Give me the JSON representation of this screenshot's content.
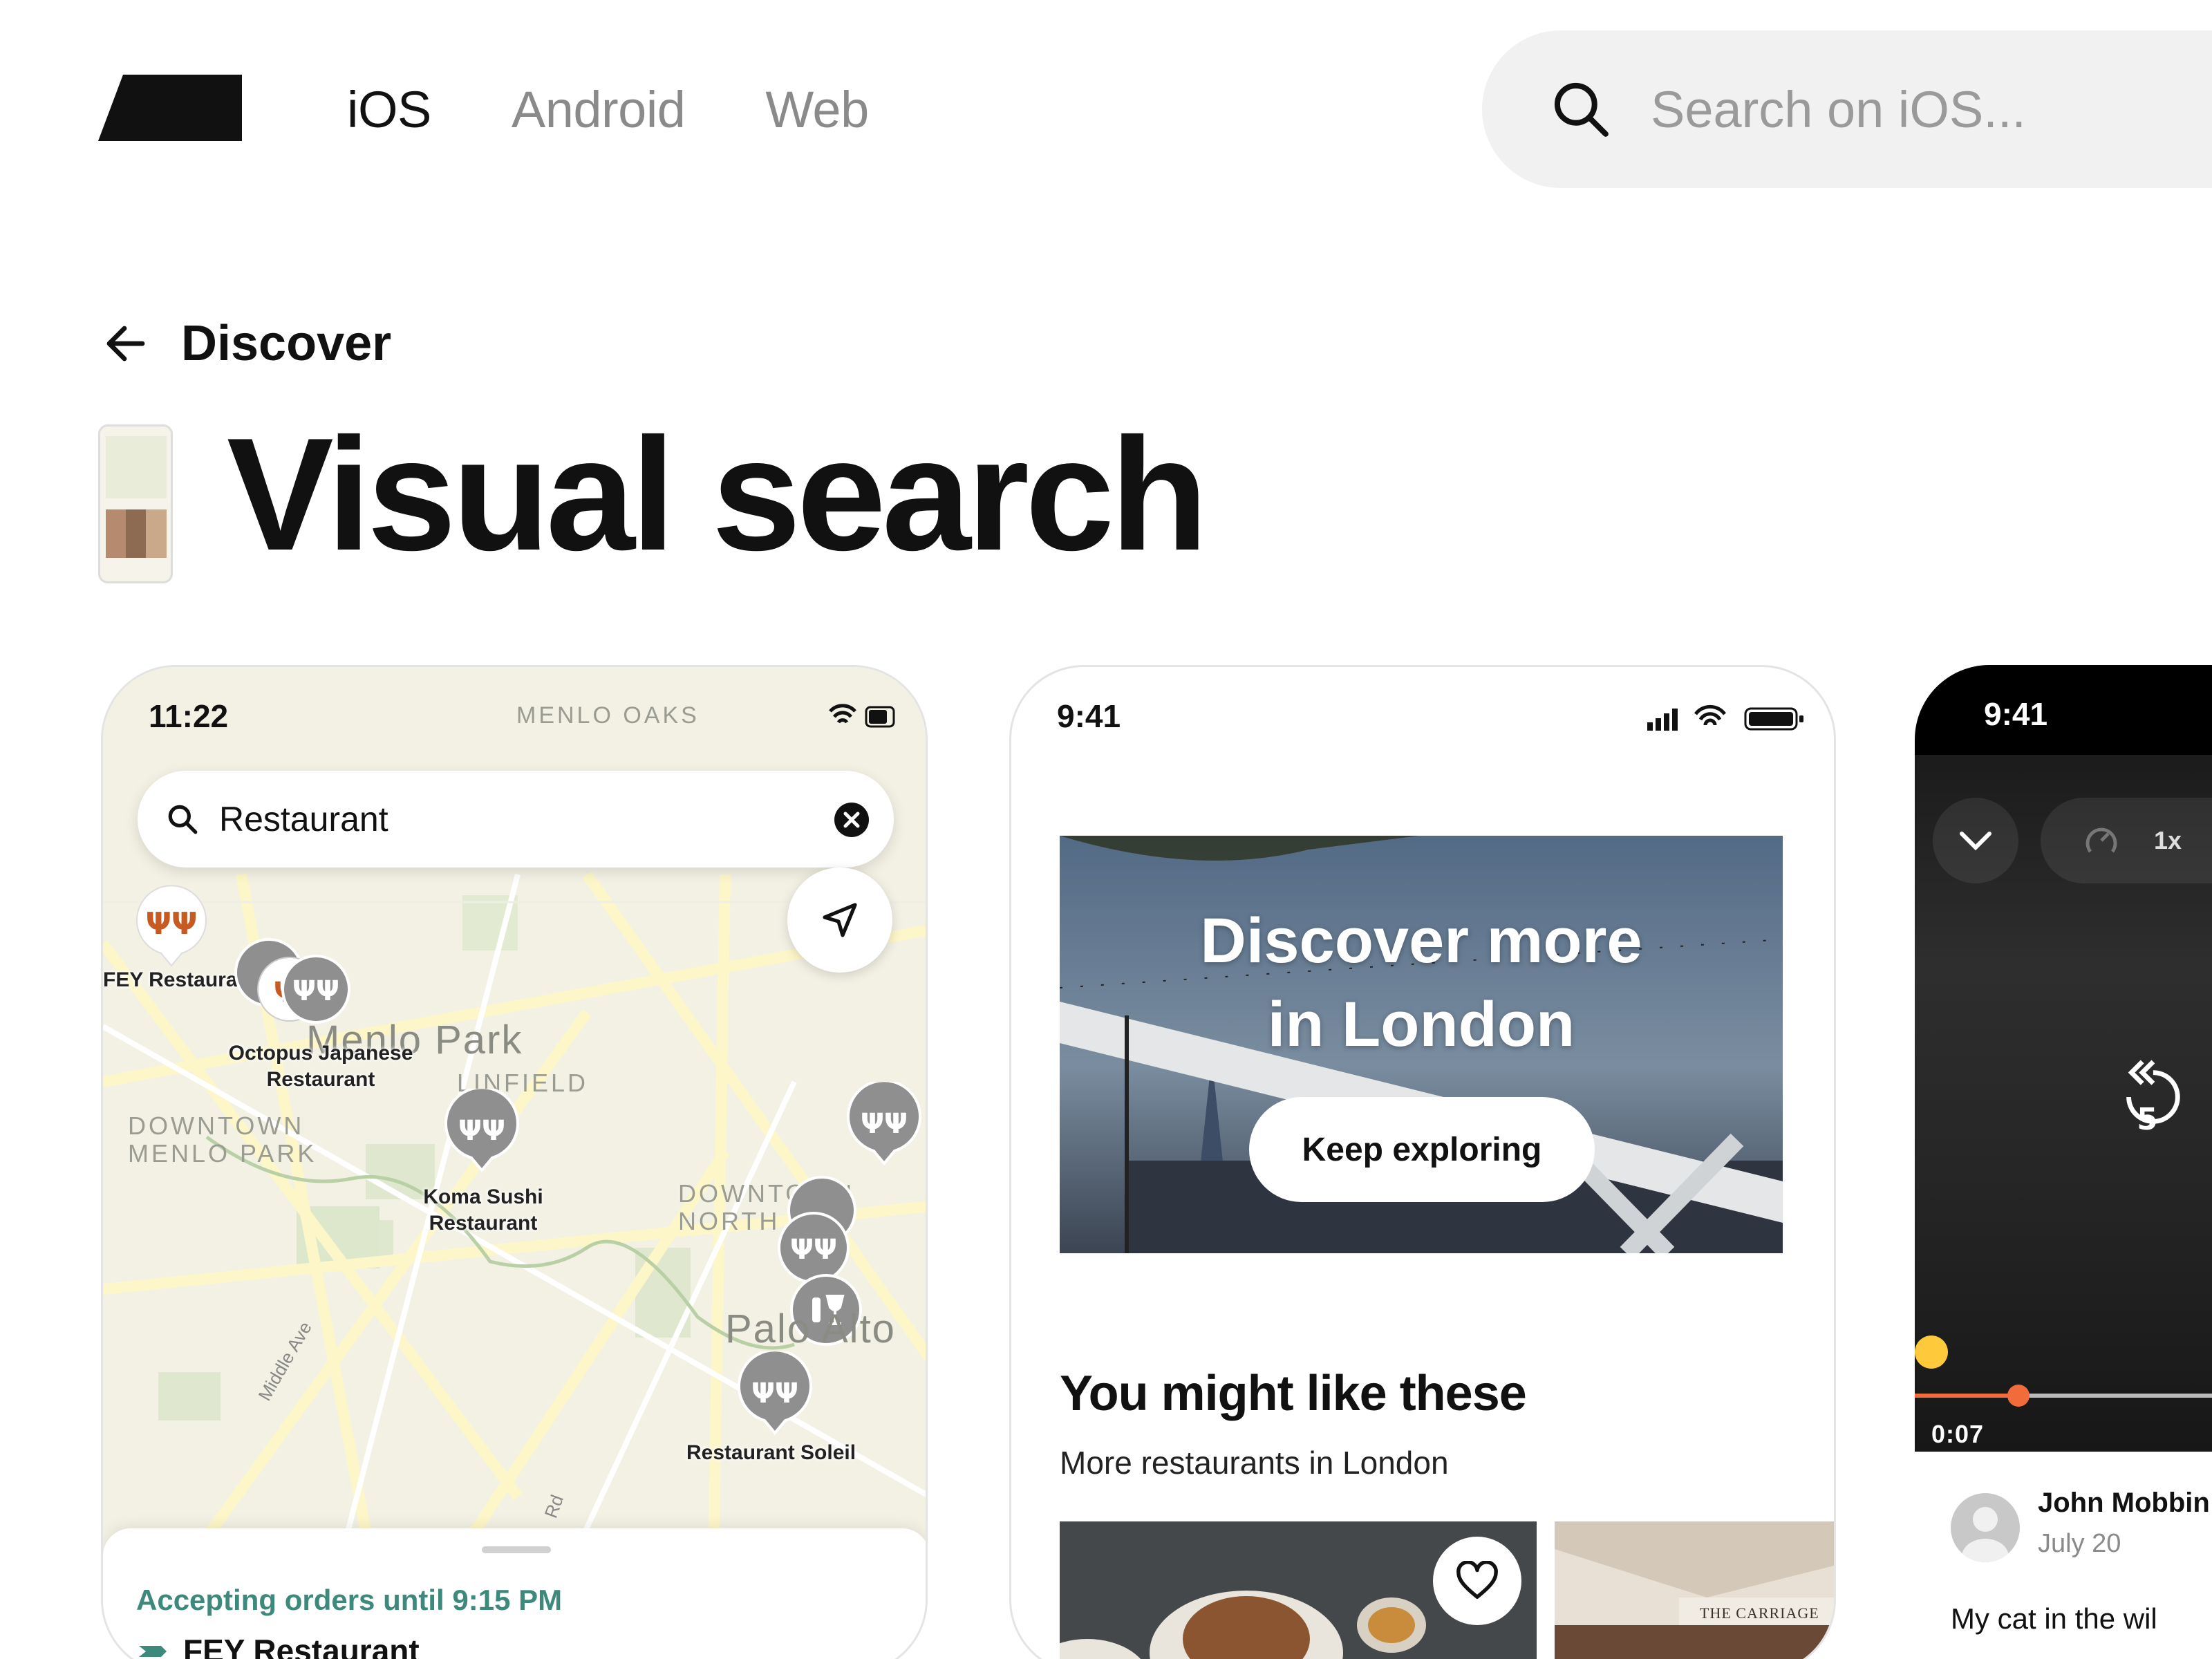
{
  "header": {
    "logo_icon": "mobbin-logo-icon",
    "nav": [
      {
        "label": "iOS",
        "active": true
      },
      {
        "label": "Android",
        "active": false
      },
      {
        "label": "Web",
        "active": false
      }
    ],
    "search": {
      "placeholder": "Search on iOS..."
    }
  },
  "breadcrumb": {
    "label": "Discover",
    "icon": "arrow-left-icon"
  },
  "page": {
    "title": "Visual search"
  },
  "cards": [
    {
      "status_time": "11:22",
      "search_value": "Restaurant",
      "map": {
        "areas": [
          "MENLO OAKS",
          "DOWNTOWN MENLO PARK",
          "LINFIELD",
          "DOWNTOWN NORTH"
        ],
        "towns": [
          "Menlo Park",
          "Palo Alto"
        ],
        "streets": [
          "Middle Ave",
          "Rd"
        ],
        "pins": [
          "FEY Restaurant",
          "Octopus Japanese Restaurant",
          "Koma Sushi Restaurant",
          "Restaurant Soleil"
        ]
      },
      "sheet": {
        "status": "Accepting orders until 9:15 PM",
        "name": "FEY Restaurant"
      }
    },
    {
      "status_time": "9:41",
      "hero": {
        "title_line1": "Discover more",
        "title_line2": "in London",
        "button": "Keep exploring"
      },
      "section": {
        "title": "You might like these",
        "subtitle": "More restaurants in London"
      },
      "thumb_text": "THE CARRIAGE"
    },
    {
      "status_time": "9:41",
      "speed": "1x",
      "rewind_seconds": "5",
      "time": "0:07",
      "progress": 0.3,
      "author": "John Mobbin",
      "date": "July 20",
      "comment": "My cat in the wil"
    }
  ],
  "colors": {
    "accent_orange": "#f26b3a",
    "accepting_green": "#3d8a7c",
    "map_pin_orange": "#c65a22"
  }
}
